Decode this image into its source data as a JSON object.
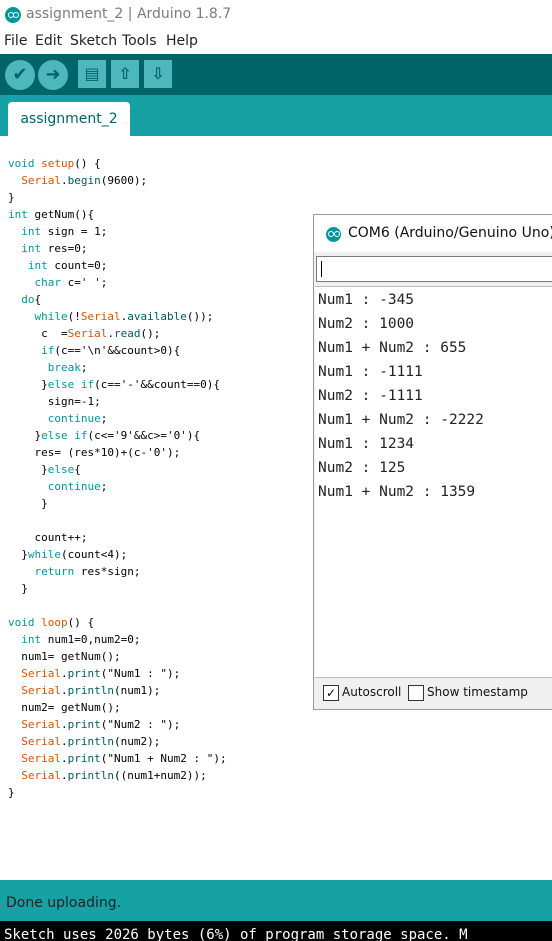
{
  "window": {
    "title": "assignment_2 | Arduino 1.8.7"
  },
  "menu": [
    "File",
    "Edit",
    "Sketch",
    "Tools",
    "Help"
  ],
  "toolbar": {
    "verify_icon": "checkmark-icon",
    "upload_icon": "arrow-right-icon",
    "new_icon": "new-file-icon",
    "open_icon": "upload-arrow-icon",
    "save_icon": "download-arrow-icon"
  },
  "tabs": [
    {
      "label": "assignment_2",
      "active": true
    }
  ],
  "editor": {
    "lines": [
      "void setup() {",
      "  Serial.begin(9600);",
      "}",
      "int getNum(){",
      "  int sign = 1;",
      "  int res=0;",
      "   int count=0;",
      "    char c=' ';",
      "  do{",
      "    while(!Serial.available());",
      "     c  =Serial.read();",
      "     if(c=='\\n'&&count>0){",
      "      break;",
      "     }else if(c=='-'&&count==0){",
      "      sign=-1;",
      "      continue;",
      "    }else if(c<='9'&&c>='0'){",
      "    res= (res*10)+(c-'0');",
      "     }else{",
      "      continue;",
      "     }",
      "",
      "    count++;",
      "  }while(count<4);",
      "    return res*sign;",
      "  }",
      "",
      "void loop() {",
      "  int num1=0,num2=0;",
      "  num1= getNum();",
      "  Serial.print(\"Num1 : \");",
      "  Serial.println(num1);",
      "  num2= getNum();",
      "  Serial.print(\"Num2 : \");",
      "  Serial.println(num2);",
      "  Serial.print(\"Num1 + Num2 : \");",
      "  Serial.println((num1+num2));",
      "}"
    ]
  },
  "serial_monitor": {
    "title": "COM6 (Arduino/Genuino Uno)",
    "input_value": "",
    "output": [
      "Num1 : -345",
      "Num2 : 1000",
      "Num1 + Num2 : 655",
      "Num1 : -1111",
      "Num2 : -1111",
      "Num1 + Num2 : -2222",
      "Num1 : 1234",
      "Num2 : 125",
      "Num1 + Num2 : 1359"
    ],
    "autoscroll_label": "Autoscroll",
    "autoscroll_checked": true,
    "timestamp_label": "Show timestamp",
    "timestamp_checked": false
  },
  "status": {
    "message": "Done uploading."
  },
  "console": {
    "text": "Sketch uses 2026 bytes (6%) of program storage space. M"
  },
  "colors": {
    "toolbar_bg": "#006468",
    "tab_strip_bg": "#17A1A5",
    "button_bg": "#4DB7BB",
    "keyword_type": "#00979C",
    "keyword_object": "#D35400"
  }
}
